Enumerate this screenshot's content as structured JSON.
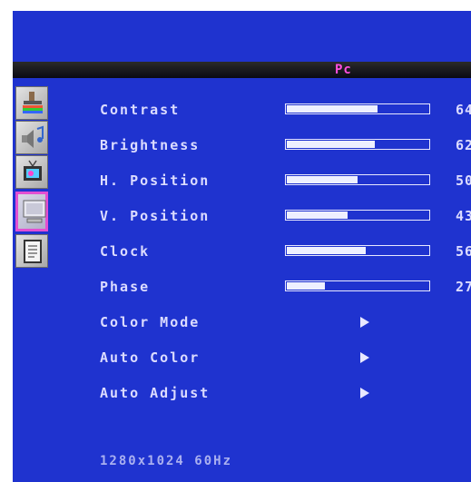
{
  "title": "Pc",
  "tabs": [
    {
      "icon": "paint-roller-icon",
      "active": false
    },
    {
      "icon": "speaker-music-icon",
      "active": false
    },
    {
      "icon": "tv-icon",
      "active": false
    },
    {
      "icon": "monitor-icon",
      "active": true
    },
    {
      "icon": "document-icon",
      "active": false
    }
  ],
  "items": [
    {
      "label": "Contrast",
      "value": "64",
      "level": 64
    },
    {
      "label": "Brightness",
      "value": "62",
      "level": 62
    },
    {
      "label": "H. Position",
      "value": "50",
      "level": 50
    },
    {
      "label": "V. Position",
      "value": "43",
      "level": 43
    },
    {
      "label": "Clock",
      "value": "56",
      "level": 56
    },
    {
      "label": "Phase",
      "value": "27",
      "level": 27
    },
    {
      "label": "Color Mode"
    },
    {
      "label": "Auto Color"
    },
    {
      "label": "Auto Adjust"
    }
  ],
  "resolution": "1280x1024 60Hz",
  "colors": {
    "background": "#1f33cf",
    "title": "#ff4fe0",
    "text": "#dcdcff",
    "active_tab_border": "#e24fd2"
  }
}
